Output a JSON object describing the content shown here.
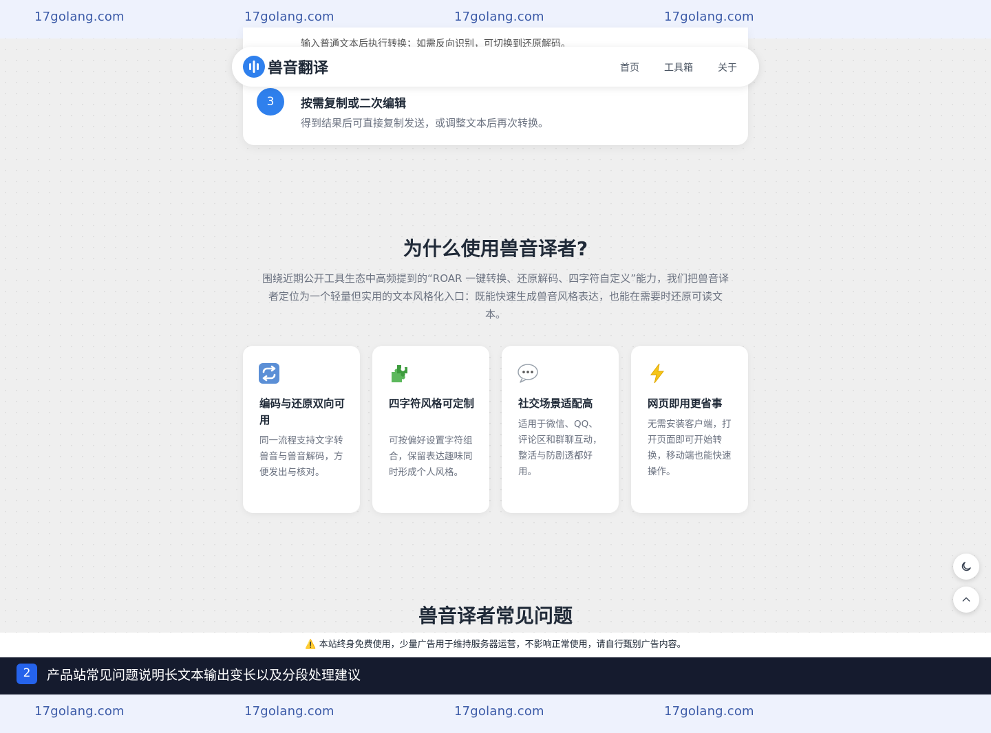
{
  "watermark": {
    "top": [
      "17golang.com",
      "17golang.com",
      "17golang.com",
      "17golang.com"
    ],
    "bottom": [
      "17golang.com",
      "17golang.com",
      "17golang.com",
      "17golang.com"
    ]
  },
  "steps": {
    "cut_text": "输入普通文本后执行转换；如需反向识别，可切换到还原解码。",
    "step3": {
      "number": "3",
      "title": "按需复制或二次编辑",
      "desc": "得到结果后可直接复制发送，或调整文本后再次转换。"
    }
  },
  "nav": {
    "logo_text": "兽音翻译",
    "links": [
      "首页",
      "工具箱",
      "关于"
    ],
    "brand_color": "#2f80ed"
  },
  "why": {
    "title": "为什么使用兽音译者?",
    "desc": "围绕近期公开工具生态中高频提到的“ROAR 一键转换、还原解码、四字符自定义”能力，我们把兽音译者定位为一个轻量但实用的文本风格化入口：既能快速生成兽音风格表达，也能在需要时还原可读文本。"
  },
  "features": [
    {
      "icon": "repeat-icon",
      "title": "编码与还原双向可用",
      "desc": "同一流程支持文字转兽音与兽音解码，方便发出与核对。"
    },
    {
      "icon": "puzzle-icon",
      "title": "四字符风格可定制",
      "desc": "可按偏好设置字符组合，保留表达趣味同时形成个人风格。"
    },
    {
      "icon": "speech-bubble-icon",
      "title": "社交场景适配高",
      "desc": "适用于微信、QQ、评论区和群聊互动，整活与防剧透都好用。"
    },
    {
      "icon": "lightning-icon",
      "title": "网页即用更省事",
      "desc": "无需安装客户端，打开页面即可开始转换，移动端也能快速操作。"
    }
  ],
  "faq": {
    "title": "兽音译者常见问题"
  },
  "notice": {
    "icon": "warning-icon",
    "text": "本站终身免费使用，少量广告用于维持服务器运营，不影响正常使用，请自行甄别广告内容。"
  },
  "caption": {
    "number": "2",
    "text": "产品站常见问题说明长文本输出变长以及分段处理建议"
  }
}
